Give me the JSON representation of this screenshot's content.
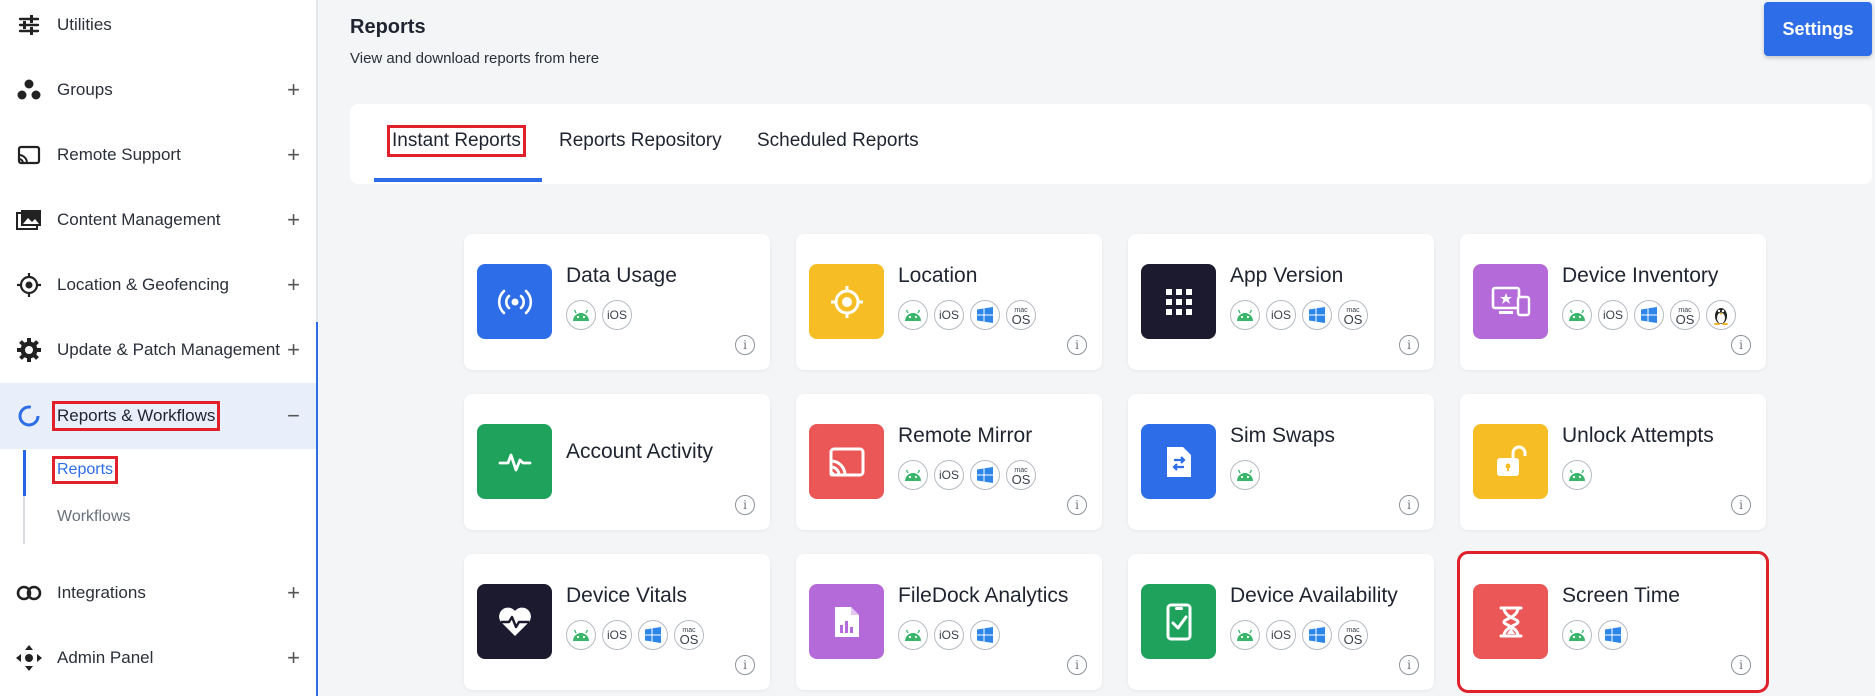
{
  "sidebar": {
    "items": [
      {
        "label": "Utilities",
        "icon": "sliders-icon",
        "expandable": false
      },
      {
        "label": "Groups",
        "icon": "groups-icon",
        "expandable": true
      },
      {
        "label": "Remote Support",
        "icon": "cast-icon",
        "expandable": true
      },
      {
        "label": "Content Management",
        "icon": "images-icon",
        "expandable": true
      },
      {
        "label": "Location & Geofencing",
        "icon": "crosshair-icon",
        "expandable": true
      },
      {
        "label": "Update & Patch Management",
        "icon": "gear-icon",
        "expandable": true
      },
      {
        "label": "Reports & Workflows",
        "icon": "reports-ring-icon",
        "expandable": true,
        "expanded": true
      },
      {
        "label": "Integrations",
        "icon": "link-icon",
        "expandable": true
      },
      {
        "label": "Admin Panel",
        "icon": "admin-icon",
        "expandable": true
      }
    ],
    "sub_items": [
      {
        "label": "Reports",
        "active": true
      },
      {
        "label": "Workflows",
        "active": false
      }
    ],
    "plus_glyph": "+",
    "minus_glyph": "−"
  },
  "header": {
    "title": "Reports",
    "subtitle": "View and download reports from here",
    "settings_label": "Settings"
  },
  "tabs": [
    {
      "label": "Instant Reports",
      "active": true
    },
    {
      "label": "Reports Repository",
      "active": false
    },
    {
      "label": "Scheduled Reports",
      "active": false
    }
  ],
  "os_labels": {
    "ios": "iOS",
    "mac_top": "mac",
    "mac_bottom": "OS"
  },
  "info_glyph": "i",
  "cards": [
    {
      "title": "Data Usage",
      "icon": "signal-icon",
      "color": "#2d6ee8",
      "os": [
        "android",
        "ios"
      ]
    },
    {
      "title": "Location",
      "icon": "target-icon",
      "color": "#f7bd24",
      "os": [
        "android",
        "ios",
        "windows",
        "macos"
      ]
    },
    {
      "title": "App Version",
      "icon": "grid-icon",
      "color": "#1b1a2e",
      "os": [
        "android",
        "ios",
        "windows",
        "macos"
      ]
    },
    {
      "title": "Device Inventory",
      "icon": "devices-icon",
      "color": "#b46ad8",
      "os": [
        "android",
        "ios",
        "windows",
        "macos",
        "linux"
      ]
    },
    {
      "title": "Account Activity",
      "icon": "pulse-icon",
      "color": "#1fa35c",
      "os": []
    },
    {
      "title": "Remote Mirror",
      "icon": "cast-icon",
      "color": "#eb5757",
      "os": [
        "android",
        "ios",
        "windows",
        "macos"
      ]
    },
    {
      "title": "Sim Swaps",
      "icon": "sim-swap-icon",
      "color": "#2d6ee8",
      "os": [
        "android"
      ]
    },
    {
      "title": "Unlock Attempts",
      "icon": "unlock-icon",
      "color": "#f7bd24",
      "os": [
        "android"
      ]
    },
    {
      "title": "Device Vitals",
      "icon": "heart-pulse-icon",
      "color": "#1b1a2e",
      "os": [
        "android",
        "ios",
        "windows",
        "macos"
      ]
    },
    {
      "title": "FileDock Analytics",
      "icon": "file-chart-icon",
      "color": "#b46ad8",
      "os": [
        "android",
        "ios",
        "windows"
      ]
    },
    {
      "title": "Device Availability",
      "icon": "phone-check-icon",
      "color": "#1fa35c",
      "os": [
        "android",
        "ios",
        "windows",
        "macos"
      ]
    },
    {
      "title": "Screen Time",
      "icon": "hourglass-icon",
      "color": "#eb5757",
      "os": [
        "android",
        "windows"
      ]
    }
  ]
}
